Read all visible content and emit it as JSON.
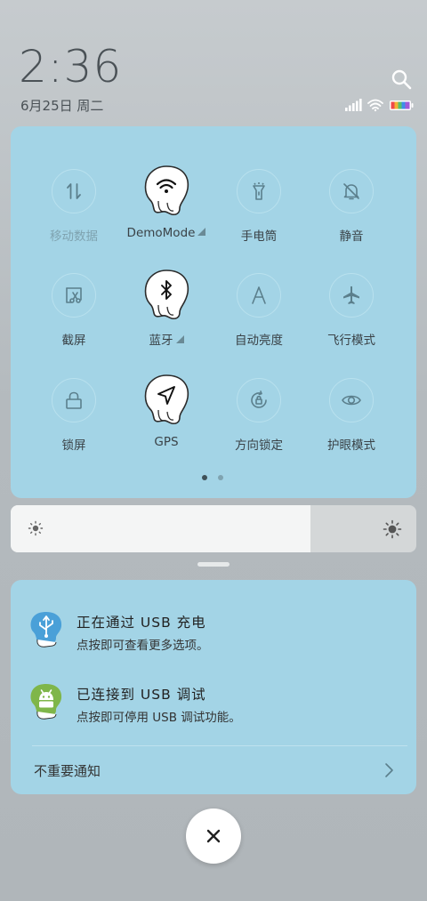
{
  "status_area": {
    "time": "2:36",
    "date": "6月25日 周二",
    "icons": [
      "signal-icon",
      "wifi-icon",
      "battery-icon"
    ]
  },
  "quick_settings": {
    "tiles": [
      {
        "label": "移动数据",
        "icon": "mobile-data-icon",
        "active": false
      },
      {
        "label": "DemoMode",
        "icon": "wifi-icon",
        "active": true,
        "has_submenu": true
      },
      {
        "label": "手电筒",
        "icon": "flashlight-icon",
        "active": false
      },
      {
        "label": "静音",
        "icon": "mute-bell-icon",
        "active": false
      },
      {
        "label": "截屏",
        "icon": "screenshot-icon",
        "active": false
      },
      {
        "label": "蓝牙",
        "icon": "bluetooth-icon",
        "active": true,
        "has_submenu": true
      },
      {
        "label": "自动亮度",
        "icon": "auto-brightness-icon",
        "active": false
      },
      {
        "label": "飞行模式",
        "icon": "airplane-icon",
        "active": false
      },
      {
        "label": "锁屏",
        "icon": "lock-icon",
        "active": false
      },
      {
        "label": "GPS",
        "icon": "location-icon",
        "active": true
      },
      {
        "label": "方向锁定",
        "icon": "rotation-lock-icon",
        "active": false
      },
      {
        "label": "护眼模式",
        "icon": "eye-icon",
        "active": false
      }
    ],
    "page_count": 2,
    "current_page": 1
  },
  "brightness": {
    "level_fraction": 0.74
  },
  "notifications": {
    "items": [
      {
        "title": "正在通过 USB 充电",
        "subtitle": "点按即可查看更多选项。",
        "icon": "usb-icon"
      },
      {
        "title": "已连接到 USB 调试",
        "subtitle": "点按即可停用 USB 调试功能。",
        "icon": "android-debug-icon"
      }
    ],
    "unimportant_label": "不重要通知"
  },
  "colors": {
    "panel": "#a3d4e6",
    "text": "#3a4247",
    "accent_blue": "#4aa0d8",
    "android_green": "#7fb64a"
  }
}
